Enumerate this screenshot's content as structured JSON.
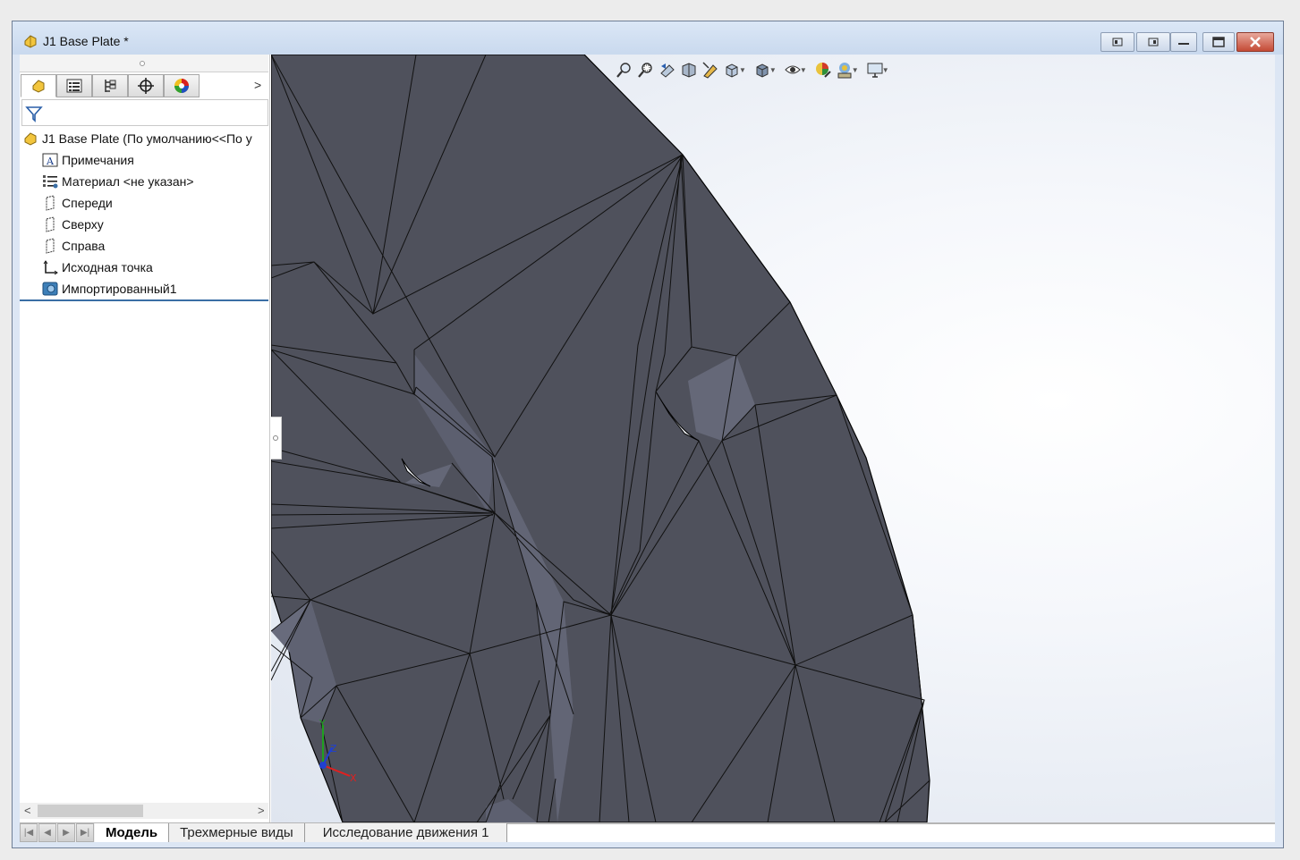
{
  "window": {
    "title": "J1 Base Plate *"
  },
  "panel": {
    "tabs": [
      {
        "icon": "feature-manager-icon"
      },
      {
        "icon": "property-manager-icon"
      },
      {
        "icon": "configuration-manager-icon"
      },
      {
        "icon": "dimxpert-manager-icon"
      },
      {
        "icon": "display-manager-icon"
      }
    ],
    "tree": {
      "root": "J1 Base Plate  (По умолчанию<<По у",
      "items": [
        {
          "label": "Примечания",
          "icon": "annotations-icon"
        },
        {
          "label": "Материал <не указан>",
          "icon": "material-icon"
        },
        {
          "label": "Спереди",
          "icon": "plane-icon"
        },
        {
          "label": "Сверху",
          "icon": "plane-icon"
        },
        {
          "label": "Справа",
          "icon": "plane-icon"
        },
        {
          "label": "Исходная точка",
          "icon": "origin-icon"
        },
        {
          "label": "Импортированный1",
          "icon": "imported-body-icon"
        }
      ]
    }
  },
  "triad": {
    "x_label": "X",
    "y_label": "Y",
    "z_label": "Z"
  },
  "bottom_tabs": {
    "model": "Модель",
    "views3d": "Трехмерные виды",
    "motion": "Исследование движения 1"
  },
  "colors": {
    "mesh_fill": "#4f515c",
    "mesh_edge": "#0a0a0a",
    "viewport_bg": "#eef1f6"
  }
}
